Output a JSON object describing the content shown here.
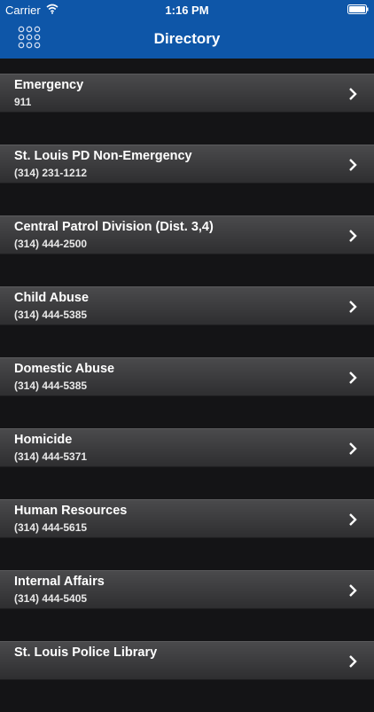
{
  "status_bar": {
    "carrier": "Carrier",
    "time": "1:16 PM"
  },
  "nav": {
    "title": "Directory",
    "menu_icon": "grid-icon"
  },
  "directory": [
    {
      "name": "Emergency",
      "phone": "911"
    },
    {
      "name": "St. Louis PD Non-Emergency",
      "phone": "(314) 231-1212"
    },
    {
      "name": "Central Patrol Division (Dist. 3,4)",
      "phone": "(314) 444-2500"
    },
    {
      "name": "Child Abuse",
      "phone": "(314) 444-5385"
    },
    {
      "name": "Domestic Abuse",
      "phone": "(314) 444-5385"
    },
    {
      "name": "Homicide",
      "phone": "(314) 444-5371"
    },
    {
      "name": "Human Resources",
      "phone": "(314) 444-5615"
    },
    {
      "name": "Internal Affairs",
      "phone": "(314) 444-5405"
    },
    {
      "name": "St. Louis Police Library",
      "phone": ""
    }
  ],
  "colors": {
    "header": "#0e56a8",
    "background": "#141416",
    "row": "#3c3c3e"
  }
}
